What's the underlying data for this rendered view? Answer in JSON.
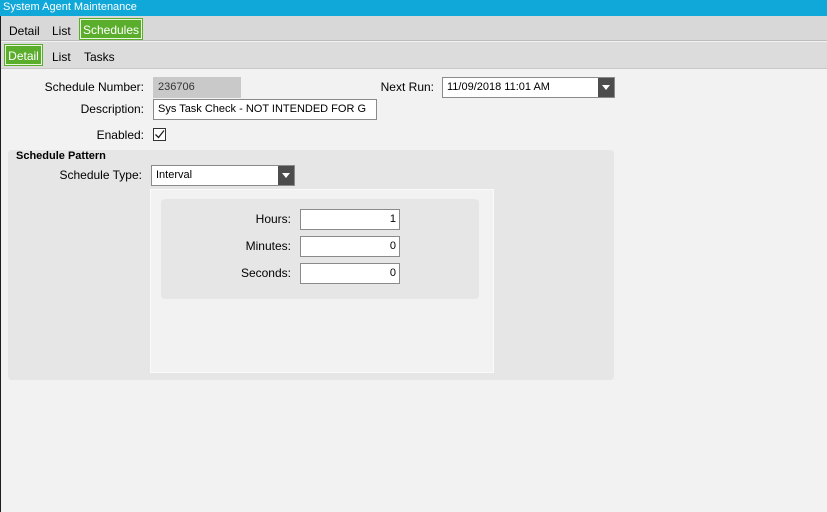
{
  "window": {
    "title": "System Agent Maintenance"
  },
  "main_tabs": [
    {
      "label": "Detail"
    },
    {
      "label": "List"
    },
    {
      "label": "Schedules",
      "active": true
    }
  ],
  "sub_tabs": [
    {
      "label": "Detail",
      "active": true
    },
    {
      "label": "List"
    },
    {
      "label": "Tasks"
    }
  ],
  "form": {
    "schedule_number_label": "Schedule Number:",
    "schedule_number_value": "236706",
    "next_run_label": "Next Run:",
    "next_run_value": "11/09/2018 11:01 AM",
    "description_label": "Description:",
    "description_value": "Sys Task Check - NOT INTENDED FOR G",
    "enabled_label": "Enabled:",
    "enabled_checked": true
  },
  "schedule_pattern": {
    "title": "Schedule Pattern",
    "type_label": "Schedule Type:",
    "type_value": "Interval",
    "hours_label": "Hours:",
    "hours_value": "1",
    "minutes_label": "Minutes:",
    "minutes_value": "0",
    "seconds_label": "Seconds:",
    "seconds_value": "0"
  },
  "colors": {
    "title_bar": "#10a7d9",
    "active_tab": "#5aae2c",
    "dropdown_button": "#4c4c4c"
  },
  "icons": {
    "dropdown": "chevron-down-icon",
    "checkmark": "checkmark-icon"
  }
}
